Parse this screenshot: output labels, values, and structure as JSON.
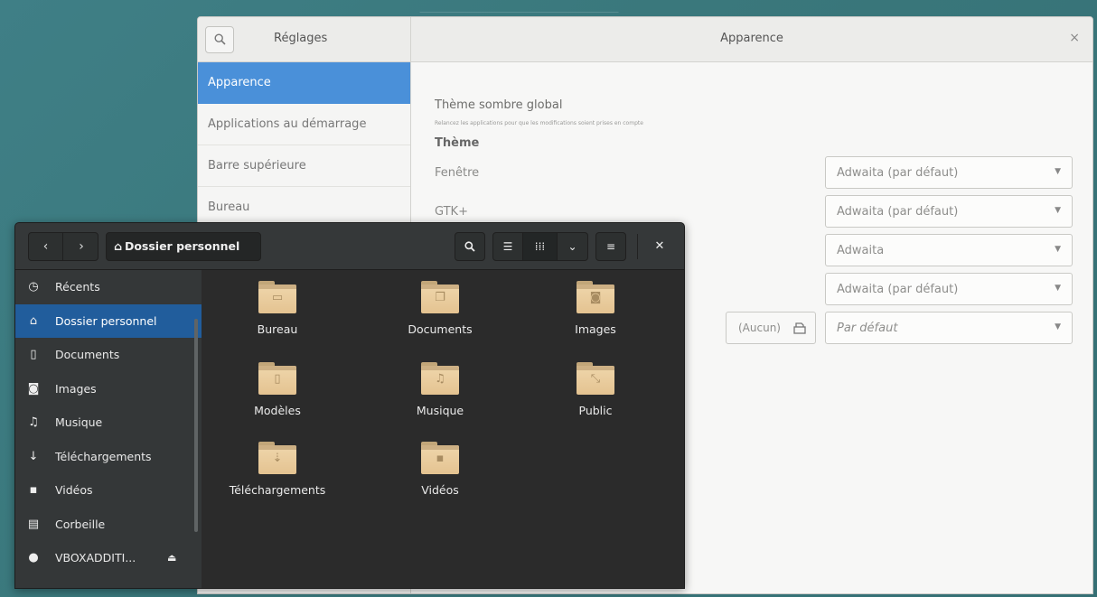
{
  "settings": {
    "app_title": "Réglages",
    "page_title": "Apparence",
    "close_glyph": "×",
    "sidebar": [
      {
        "label": "Apparence",
        "active": true
      },
      {
        "label": "Applications au démarrage",
        "active": false
      },
      {
        "label": "Barre supérieure",
        "active": false
      },
      {
        "label": "Bureau",
        "active": false
      }
    ],
    "dark_theme": {
      "label": "Thème sombre global",
      "help": "Relancez les applications pour que les modifications soient prises en compte",
      "toggle_label": "I",
      "enabled": true
    },
    "theme_heading": "Thème",
    "rows": [
      {
        "label": "Fenêtre",
        "value": "Adwaita (par défaut)"
      },
      {
        "label": "GTK+",
        "value": "Adwaita (par défaut)"
      },
      {
        "label": "",
        "value": "Adwaita"
      },
      {
        "label": "",
        "value": "Adwaita (par défaut)"
      },
      {
        "label": "",
        "value": "Par défaut"
      }
    ],
    "aucun_button": "(Aucun)"
  },
  "files": {
    "path": "Dossier personnel",
    "icons": {
      "back": "chevron-left-icon",
      "forward": "chevron-right-icon",
      "search": "search-icon",
      "list_view": "list-view-icon",
      "grid_view": "grid-view-icon",
      "view_options": "chevron-down-icon",
      "menu": "hamburger-icon",
      "close": "close-icon"
    },
    "sidebar": [
      {
        "label": "Récents",
        "icon": "clock-icon",
        "active": false
      },
      {
        "label": "Dossier personnel",
        "icon": "home-icon",
        "active": true
      },
      {
        "label": "Documents",
        "icon": "document-icon",
        "active": false
      },
      {
        "label": "Images",
        "icon": "camera-icon",
        "active": false
      },
      {
        "label": "Musique",
        "icon": "music-icon",
        "active": false
      },
      {
        "label": "Téléchargements",
        "icon": "download-icon",
        "active": false
      },
      {
        "label": "Vidéos",
        "icon": "video-icon",
        "active": false
      },
      {
        "label": "Corbeille",
        "icon": "trash-icon",
        "active": false
      },
      {
        "label": "VBOXADDITI...",
        "icon": "disc-icon",
        "active": false
      }
    ],
    "folders": [
      {
        "label": "Bureau",
        "icon": "desktop-folder-icon"
      },
      {
        "label": "Documents",
        "icon": "documents-folder-icon"
      },
      {
        "label": "Images",
        "icon": "pictures-folder-icon"
      },
      {
        "label": "Modèles",
        "icon": "templates-folder-icon"
      },
      {
        "label": "Musique",
        "icon": "music-folder-icon"
      },
      {
        "label": "Public",
        "icon": "public-folder-icon"
      },
      {
        "label": "Téléchargements",
        "icon": "downloads-folder-icon"
      },
      {
        "label": "Vidéos",
        "icon": "videos-folder-icon"
      }
    ]
  },
  "colors": {
    "accent": "#4a90d9",
    "files_selection": "#215d9c",
    "desktop": "#3a787c",
    "folder": "#e4c391"
  }
}
